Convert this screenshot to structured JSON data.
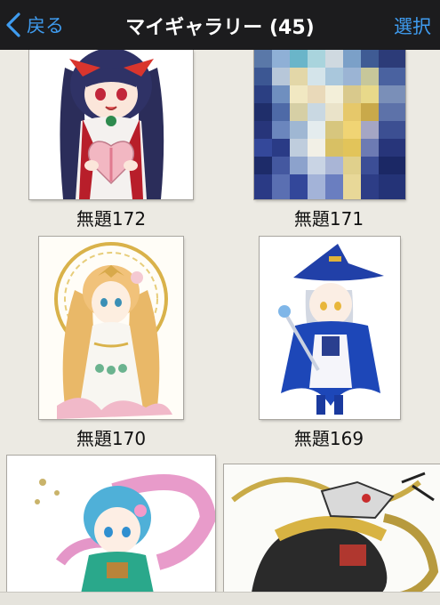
{
  "nav": {
    "back_label": "戻る",
    "title": "マイギャラリー (45)",
    "select_label": "選択"
  },
  "gallery": {
    "items": [
      {
        "caption": "無題172"
      },
      {
        "caption": "無題171"
      },
      {
        "caption": "無題170"
      },
      {
        "caption": "無題169"
      },
      {
        "caption": ""
      },
      {
        "caption": ""
      }
    ]
  },
  "colors": {
    "navbar_bg": "#1c1c1e",
    "accent": "#3f9cf0",
    "page_bg": "#eceae3"
  }
}
